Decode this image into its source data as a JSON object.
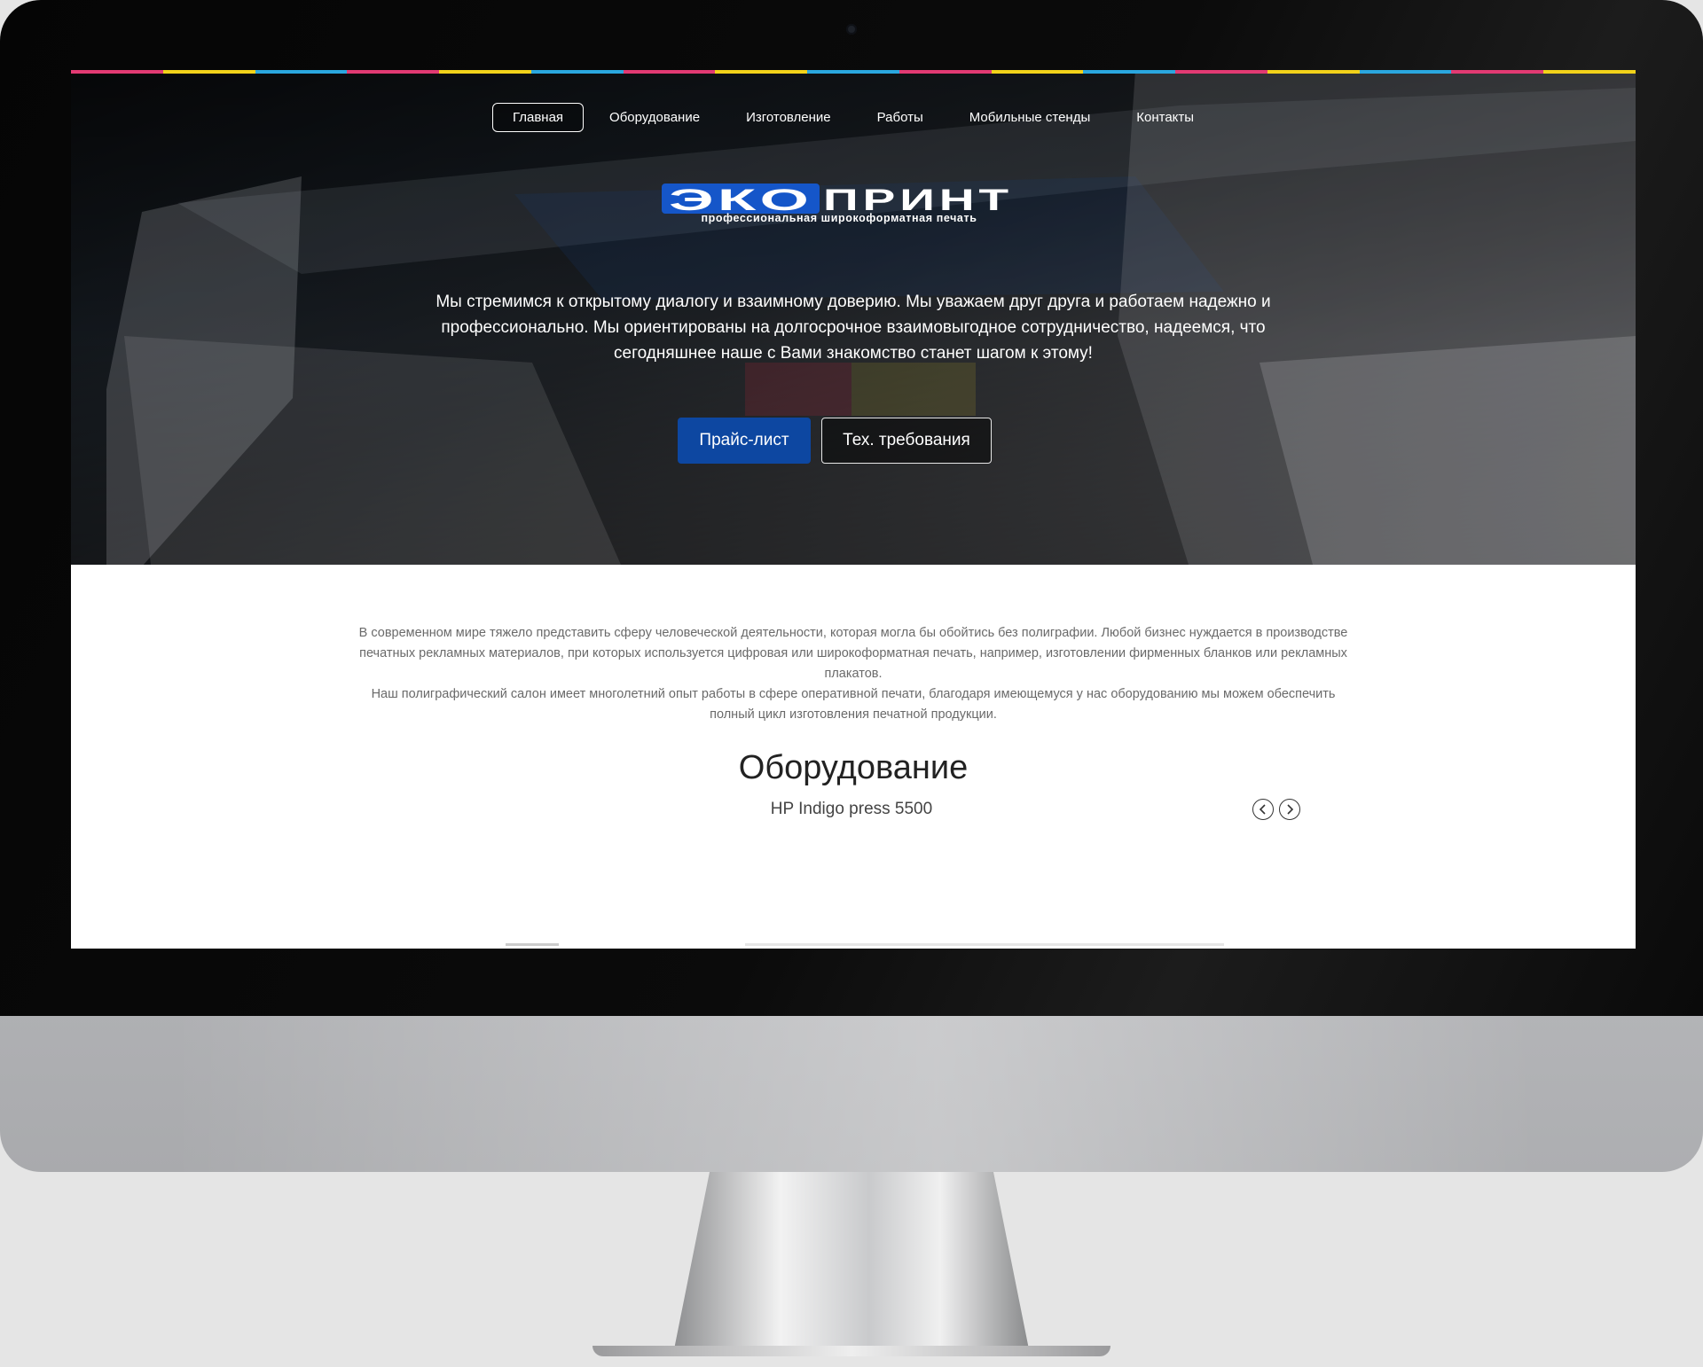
{
  "theme": {
    "accent": "#0d47a1",
    "stripe_colors": [
      "#e23a73",
      "#f2d21a",
      "#2aa7df",
      "#e23a73",
      "#f2d21a",
      "#2aa7df",
      "#e23a73",
      "#f2d21a",
      "#2aa7df",
      "#e23a73",
      "#f2d21a",
      "#2aa7df",
      "#e23a73",
      "#f2d21a",
      "#2aa7df",
      "#e23a73",
      "#f2d21a"
    ]
  },
  "nav": {
    "items": [
      {
        "label": "Главная",
        "active": true
      },
      {
        "label": "Оборудование",
        "active": false
      },
      {
        "label": "Изготовление",
        "active": false
      },
      {
        "label": "Работы",
        "active": false
      },
      {
        "label": "Мобильные стенды",
        "active": false
      },
      {
        "label": "Контакты",
        "active": false
      }
    ]
  },
  "logo": {
    "part1": "ЭКО",
    "part2": "ПРИНТ",
    "tagline": "профессиональная широкоформатная печать"
  },
  "hero": {
    "text": "Мы стремимся к открытому диалогу и взаимному доверию. Мы уважаем друг друга и работаем надежно и профессионально. Мы ориентированы на долгосрочное взаимовыгодное сотрудничество, надеемся, что сегодняшнее наше с Вами знакомство станет шагом к этому!",
    "price_button": "Прайс-лист",
    "requirements_button": "Тех. требования"
  },
  "intro": {
    "paragraph1": "В современном мире тяжело представить сферу человеческой деятельности, которая могла бы обойтись без полиграфии. Любой бизнес нуждается в производстве печатных рекламных материалов, при которых используется цифровая или широкоформатная печать, например, изготовлении фирменных бланков или рекламных плакатов.",
    "paragraph2": "Наш полиграфический салон имеет многолетний опыт работы в сфере оперативной печати, благодаря имеющемуся у нас оборудованию мы можем обеспечить полный цикл изготовления печатной продукции."
  },
  "equipment": {
    "title": "Оборудование",
    "current_slide": "HP Indigo press 5500",
    "prev_icon": "chevron-left-icon",
    "next_icon": "chevron-right-icon"
  }
}
